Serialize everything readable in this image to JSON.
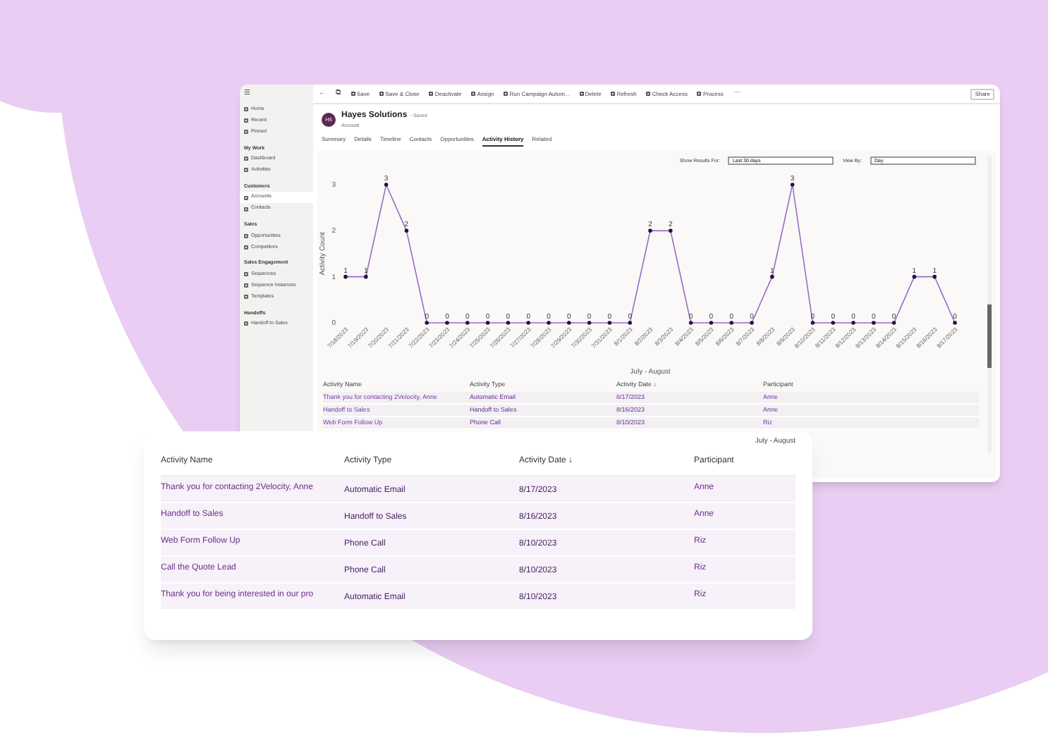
{
  "toolbar": {
    "items": [
      {
        "kind": "back",
        "label": "←"
      },
      {
        "kind": "page",
        "label": "⧉"
      },
      {
        "kind": "button",
        "label": "Save"
      },
      {
        "kind": "button",
        "label": "Save & Close"
      },
      {
        "kind": "button",
        "label": "Deactivate"
      },
      {
        "kind": "button",
        "label": "Assign"
      },
      {
        "kind": "button",
        "label": "Run Campaign Autom..."
      },
      {
        "kind": "button",
        "label": "Delete"
      },
      {
        "kind": "button",
        "label": "Refresh"
      },
      {
        "kind": "button",
        "label": "Check Access"
      },
      {
        "kind": "button",
        "label": "Process"
      },
      {
        "kind": "more",
        "label": "⋯"
      }
    ],
    "share": "Share"
  },
  "sidebar": {
    "menu": "☰",
    "items": [
      {
        "kind": "item",
        "label": "Home",
        "selected": false
      },
      {
        "kind": "item",
        "label": "Recent",
        "selected": false
      },
      {
        "kind": "item",
        "label": "Pinned",
        "selected": false
      },
      {
        "kind": "section",
        "label": "My Work"
      },
      {
        "kind": "item",
        "label": "Dashboard",
        "selected": false
      },
      {
        "kind": "item",
        "label": "Activities",
        "selected": false
      },
      {
        "kind": "section",
        "label": "Customers"
      },
      {
        "kind": "item",
        "label": "Accounts",
        "selected": true
      },
      {
        "kind": "item",
        "label": "Contacts",
        "selected": false
      },
      {
        "kind": "section",
        "label": "Sales"
      },
      {
        "kind": "item",
        "label": "Opportunities",
        "selected": false
      },
      {
        "kind": "item",
        "label": "Competitors",
        "selected": false
      },
      {
        "kind": "section",
        "label": "Sales Engagement"
      },
      {
        "kind": "item",
        "label": "Sequences",
        "selected": false
      },
      {
        "kind": "item",
        "label": "Sequence Instances",
        "selected": false
      },
      {
        "kind": "item",
        "label": "Templates",
        "selected": false
      },
      {
        "kind": "section",
        "label": "Handoffs"
      },
      {
        "kind": "item",
        "label": "Handoff to Sales",
        "selected": false
      }
    ]
  },
  "record": {
    "avatar": "HS",
    "title": "Hayes Solutions",
    "status": "- Saved",
    "subtitle": "Account"
  },
  "tabs": [
    {
      "label": "Summary",
      "selected": false
    },
    {
      "label": "Details",
      "selected": false
    },
    {
      "label": "Timeline",
      "selected": false
    },
    {
      "label": "Contacts",
      "selected": false
    },
    {
      "label": "Opportunities",
      "selected": false
    },
    {
      "label": "Activity History",
      "selected": true
    },
    {
      "label": "Related",
      "selected": false
    }
  ],
  "filters": [
    {
      "label": "Show Results For:",
      "value": "Last 30 days"
    },
    {
      "label": "View By:",
      "value": "Day"
    }
  ],
  "chart_data": {
    "type": "line",
    "xlabel": "July - August",
    "ylabel": "Activity Count",
    "ylim": [
      0,
      3
    ],
    "yticks": [
      0,
      1,
      2,
      3
    ],
    "data_labels": true,
    "categories": [
      "7/18/2023",
      "7/19/2023",
      "7/20/2023",
      "7/21/2023",
      "7/22/2023",
      "7/23/2023",
      "7/24/2023",
      "7/25/2023",
      "7/26/2023",
      "7/27/2023",
      "7/28/2023",
      "7/29/2023",
      "7/30/2023",
      "7/31/2023",
      "8/1/2023",
      "8/2/2023",
      "8/3/2023",
      "8/4/2023",
      "8/5/2023",
      "8/6/2023",
      "8/7/2023",
      "8/8/2023",
      "8/9/2023",
      "8/10/2023",
      "8/11/2023",
      "8/12/2023",
      "8/13/2023",
      "8/14/2023",
      "8/15/2023",
      "8/16/2023",
      "8/17/2023"
    ],
    "values": [
      1,
      1,
      3,
      2,
      0,
      0,
      0,
      0,
      0,
      0,
      0,
      0,
      0,
      0,
      0,
      2,
      2,
      0,
      0,
      0,
      0,
      1,
      3,
      0,
      0,
      0,
      0,
      0,
      1,
      1,
      0
    ]
  },
  "table": {
    "columns": [
      "Activity Name",
      "Activity Type",
      "Activity Date ↓",
      "Participant"
    ],
    "rows": [
      [
        "Thank you for contacting 2Velocity, Anne",
        "Automatic Email",
        "8/17/2023",
        "Anne"
      ],
      [
        "Handoff to Sales",
        "Handoff to Sales",
        "8/16/2023",
        "Anne"
      ],
      [
        "Web Form Follow Up",
        "Phone Call",
        "8/10/2023",
        "Riz"
      ]
    ]
  },
  "card": {
    "caption": "July - August",
    "columns": [
      "Activity Name",
      "Activity Type",
      "Activity Date ↓",
      "Participant"
    ],
    "rows": [
      [
        "Thank you for contacting 2Velocity, Anne",
        "Automatic Email",
        "8/17/2023",
        "Anne"
      ],
      [
        "Handoff to Sales",
        "Handoff to Sales",
        "8/16/2023",
        "Anne"
      ],
      [
        "Web Form Follow Up",
        "Phone Call",
        "8/10/2023",
        "Riz"
      ],
      [
        "Call the Quote Lead",
        "Phone Call",
        "8/10/2023",
        "Riz"
      ],
      [
        "Thank you for being interested in our pro",
        "Automatic Email",
        "8/10/2023",
        "Riz"
      ]
    ]
  }
}
